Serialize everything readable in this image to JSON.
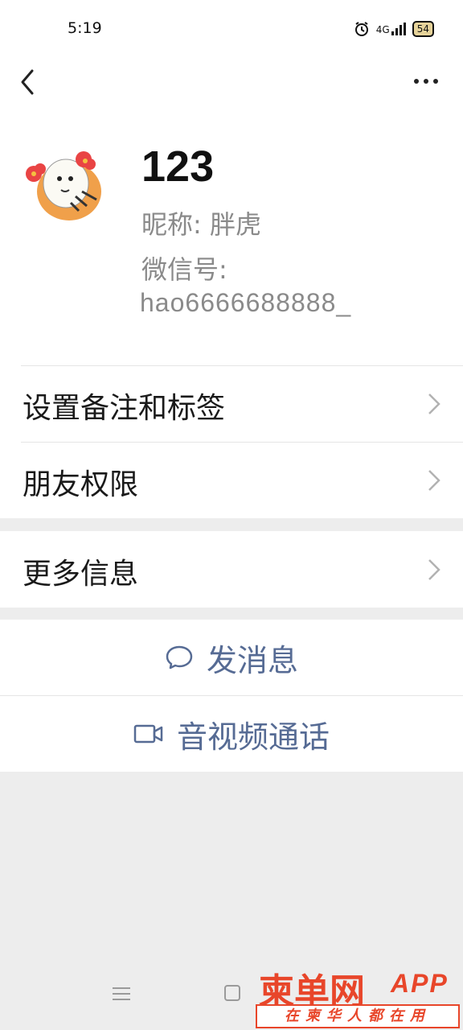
{
  "status_bar": {
    "time": "5:19",
    "network": "4G",
    "battery": "54"
  },
  "nav": {
    "back_icon": "chevron-left-icon",
    "more_icon": "more-dots-icon"
  },
  "profile": {
    "name": "123",
    "nickname": "昵称:  胖虎",
    "wechat_id_label": "微信号:",
    "wechat_id": "hao6666688888_"
  },
  "menu": {
    "remark_tags": "设置备注和标签",
    "friend_permissions": "朋友权限",
    "more_info": "更多信息"
  },
  "actions": {
    "send_message": "发消息",
    "av_call": "音视频通话"
  },
  "watermark": {
    "logo_text": "柬单网",
    "app": "APP",
    "slogan": "在柬华人都在用"
  },
  "colors": {
    "accent": "#566b94",
    "watermark": "#e8462a",
    "background": "#ededed"
  }
}
